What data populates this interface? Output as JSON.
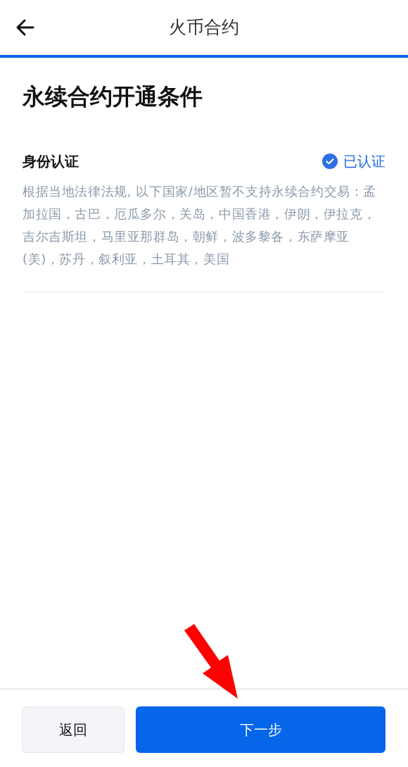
{
  "header": {
    "title": "火币合约",
    "progress": {
      "level": 1
    }
  },
  "page_title": "永续合约开通条件",
  "conditions": [
    {
      "label": "身份认证",
      "status": "已认证",
      "verified": true,
      "note": "根据当地法律法规, 以下国家/地区暂不支持永续合约交易：孟加拉国，古巴，厄瓜多尔，关岛，中国香港，伊朗，伊拉克，吉尔吉斯坦，马里亚那群岛，朝鲜，波多黎各，东萨摩亚(美)，苏丹，叙利亚，土耳其，美国"
    }
  ],
  "buttons": [
    {
      "label": "返回",
      "kind": "secondary"
    },
    {
      "label": "下一步",
      "kind": "primary"
    }
  ]
}
